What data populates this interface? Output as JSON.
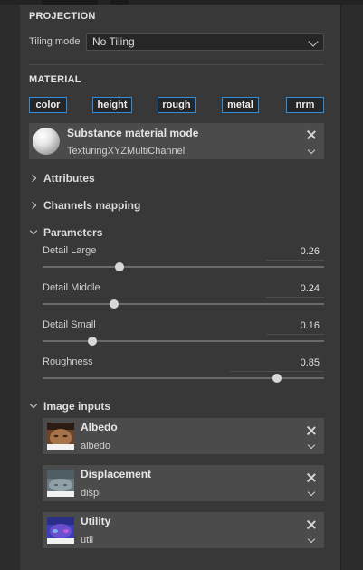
{
  "projection": {
    "section_title": "PROJECTION",
    "tiling_label": "Tiling mode",
    "tiling_value": "No Tiling"
  },
  "material": {
    "section_title": "MATERIAL",
    "channels": [
      "color",
      "height",
      "rough",
      "metal",
      "nrm"
    ],
    "card": {
      "title": "Substance material mode",
      "value": "TexturingXYZMultiChannel",
      "close_icon": "close-icon",
      "dropdown_icon": "chevron-down-icon"
    }
  },
  "groups": {
    "attributes": "Attributes",
    "channels_mapping": "Channels mapping",
    "parameters": "Parameters",
    "image_inputs": "Image inputs"
  },
  "parameters": [
    {
      "label": "Detail Large",
      "value": "0.26",
      "fraction": 0.26
    },
    {
      "label": "Detail Middle",
      "value": "0.24",
      "fraction": 0.24
    },
    {
      "label": "Detail Small",
      "value": "0.16",
      "fraction": 0.16
    },
    {
      "label": "Roughness",
      "value": "0.85",
      "fraction": 0.85
    }
  ],
  "image_inputs": [
    {
      "title": "Albedo",
      "value": "albedo",
      "thumb": "albedo-thumbnail"
    },
    {
      "title": "Displacement",
      "value": "displ",
      "thumb": "displacement-thumbnail"
    },
    {
      "title": "Utility",
      "value": "util",
      "thumb": "utility-thumbnail"
    }
  ],
  "colors": {
    "accent": "#2d8ee0",
    "panel": "#383838",
    "card": "#4b4b4b"
  }
}
